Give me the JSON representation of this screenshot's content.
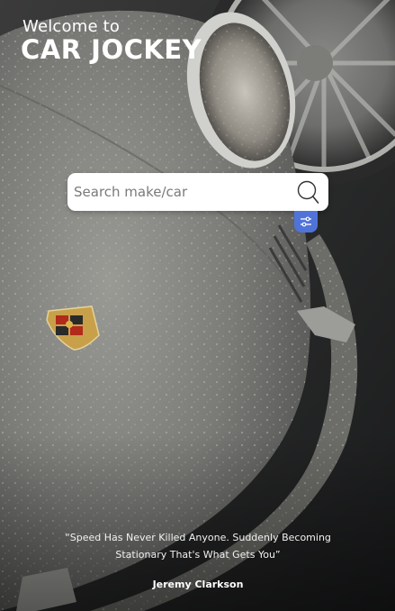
{
  "header": {
    "welcome_text": "Welcome to",
    "brand_name": "CAR JOCKEY"
  },
  "search": {
    "placeholder": "Search make/car",
    "value": ""
  },
  "icons": {
    "search": "search-icon",
    "filter": "filter-sliders-icon",
    "emblem": "car-emblem-icon"
  },
  "colors": {
    "filter_button": "#4f73d8",
    "search_background": "#ffffff"
  },
  "quote": {
    "text": "“Speed Has Never Killed Anyone. Suddenly Becoming Stationary That's What Gets You”",
    "author": "Jeremy Clarkson"
  }
}
